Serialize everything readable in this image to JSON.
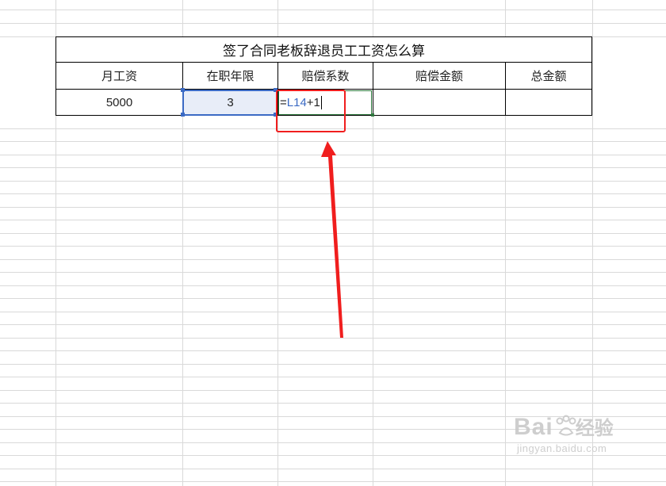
{
  "sheet": {
    "title": "签了合同老板辞退员工工资怎么算",
    "headers": [
      "月工资",
      "在职年限",
      "赔偿系数",
      "赔偿金额",
      "总金额"
    ],
    "row": {
      "monthly_salary": "5000",
      "years": "3",
      "formula_eq": "=",
      "formula_ref": "L14",
      "formula_rest": "+1",
      "compensation_amount": "",
      "total_amount": ""
    }
  },
  "annotation": {
    "color": "#f01e1e"
  },
  "watermark": {
    "logo_text": "Bai",
    "logo_suffix": "经验",
    "url": "jingyan.baidu.com"
  },
  "colors": {
    "selection_blue": "#3b6ac4",
    "active_green": "#2f7a3e",
    "grid": "#d9d9d9"
  }
}
